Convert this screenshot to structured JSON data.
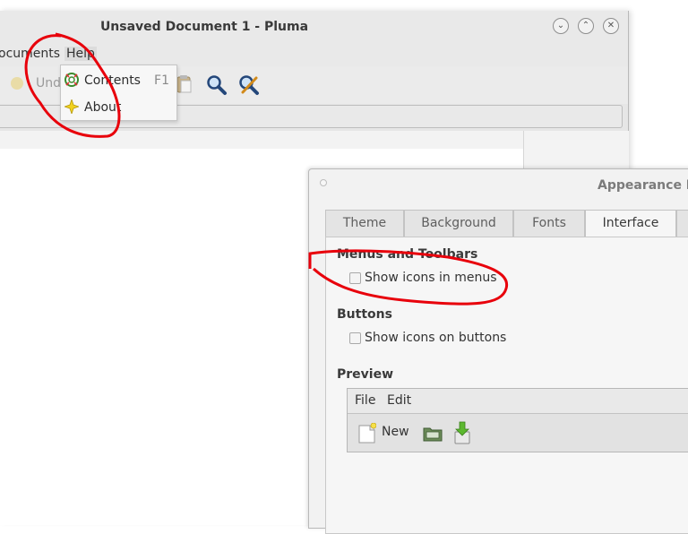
{
  "pluma": {
    "title": "Unsaved Document 1 - Pluma",
    "menu": {
      "documents_partial": "ocuments",
      "help": "Help"
    },
    "toolbar": {
      "undo_partial": "Und"
    }
  },
  "help_menu": {
    "items": [
      {
        "label": "Contents",
        "accel": "F1"
      },
      {
        "label": "About",
        "accel": ""
      }
    ]
  },
  "appearance": {
    "title": "Appearance Pre",
    "tabs": [
      "Theme",
      "Background",
      "Fonts",
      "Interface"
    ],
    "active_tab": "Interface",
    "sections": {
      "menus_toolbars": {
        "heading": "Menus and Toolbars",
        "checkbox": "Show icons in menus",
        "checked": false
      },
      "buttons": {
        "heading": "Buttons",
        "checkbox": "Show icons on buttons",
        "checked": false
      },
      "preview": {
        "heading": "Preview",
        "menu": [
          "File",
          "Edit"
        ],
        "toolbar_new": "New"
      }
    }
  },
  "annotation_color": "#e8000b"
}
